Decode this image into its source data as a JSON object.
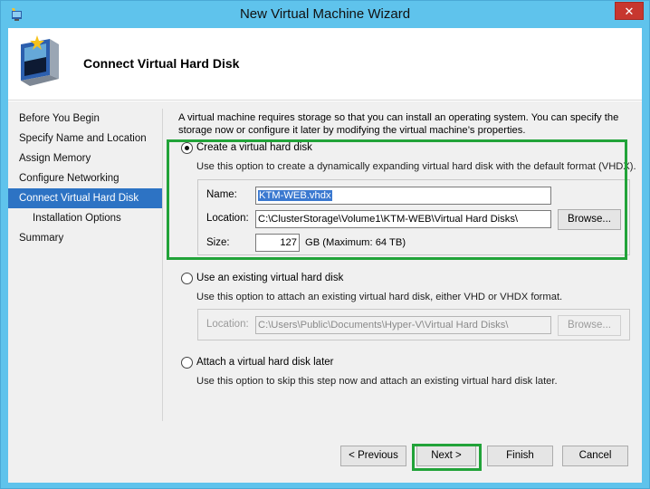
{
  "window": {
    "title": "New Virtual Machine Wizard",
    "close_label": "✕"
  },
  "header": {
    "title": "Connect Virtual Hard Disk"
  },
  "nav": {
    "items": [
      {
        "label": "Before You Begin"
      },
      {
        "label": "Specify Name and Location"
      },
      {
        "label": "Assign Memory"
      },
      {
        "label": "Configure Networking"
      },
      {
        "label": "Connect Virtual Hard Disk"
      },
      {
        "label": "Installation Options"
      },
      {
        "label": "Summary"
      }
    ],
    "active_index": 4
  },
  "content": {
    "intro_line1": "A virtual machine requires storage so that you can install an operating system. You can specify the",
    "intro_line2": "storage now or configure it later by modifying the virtual machine’s properties.",
    "option_create": {
      "label": "Create a virtual hard disk",
      "description": "Use this option to create a dynamically expanding virtual hard disk with the default format (VHDX).",
      "selected": true,
      "name_label": "Name:",
      "name_value": "KTM-WEB.vhdx",
      "location_label": "Location:",
      "location_value": "C:\\ClusterStorage\\Volume1\\KTM-WEB\\Virtual Hard Disks\\",
      "browse_label": "Browse...",
      "size_label": "Size:",
      "size_value": "127",
      "size_unit": "GB (Maximum: 64 TB)"
    },
    "option_existing": {
      "label": "Use an existing virtual hard disk",
      "description": "Use this option to attach an existing virtual hard disk, either VHD or VHDX format.",
      "selected": false,
      "location_label": "Location:",
      "location_value": "C:\\Users\\Public\\Documents\\Hyper-V\\Virtual Hard Disks\\",
      "browse_label": "Browse..."
    },
    "option_later": {
      "label": "Attach a virtual hard disk later",
      "description": "Use this option to skip this step now and attach an existing virtual hard disk later.",
      "selected": false
    }
  },
  "footer": {
    "previous_label": "< Previous",
    "next_label": "Next >",
    "finish_label": "Finish",
    "cancel_label": "Cancel"
  },
  "colors": {
    "titlebar": "#5fc3ec",
    "nav_active": "#2d73c4",
    "highlight_box": "#22a339"
  }
}
